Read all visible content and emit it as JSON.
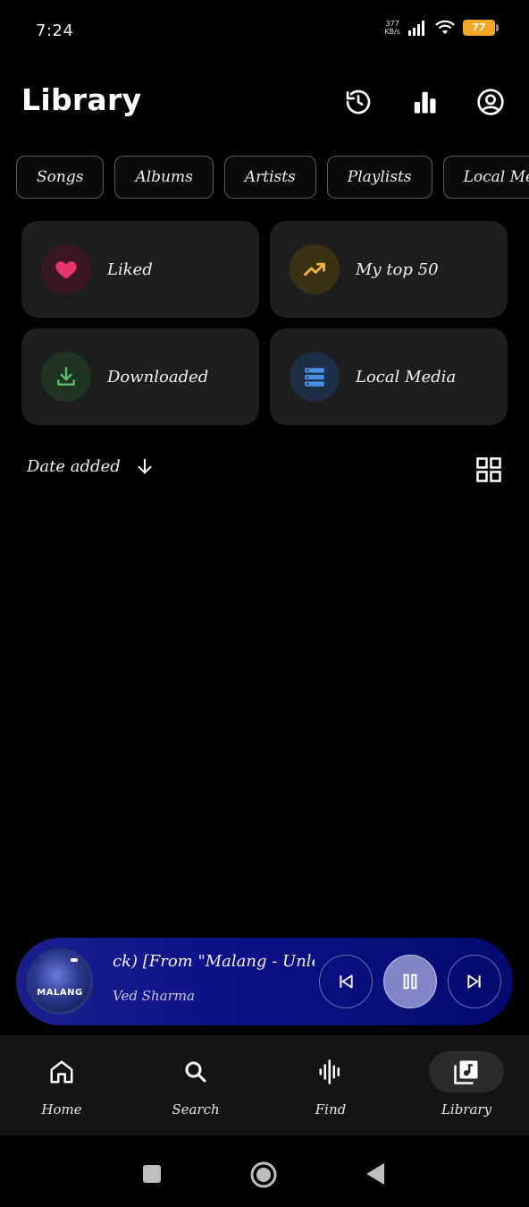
{
  "status": {
    "time": "7:24",
    "net_speed_value": "377",
    "net_speed_unit": "KB/s",
    "battery": "77"
  },
  "header": {
    "title": "Library",
    "icons": [
      "history-icon",
      "stats-icon",
      "account-icon"
    ]
  },
  "chips": [
    {
      "label": "Songs"
    },
    {
      "label": "Albums"
    },
    {
      "label": "Artists"
    },
    {
      "label": "Playlists"
    },
    {
      "label": "Local Media"
    }
  ],
  "cards": [
    {
      "label": "Liked",
      "icon": "heart-icon",
      "icon_color": "#e8346a",
      "bg": "#3a1822"
    },
    {
      "label": "My top 50",
      "icon": "trending-up-icon",
      "icon_color": "#f2b632",
      "bg": "#3a3014"
    },
    {
      "label": "Downloaded",
      "icon": "download-icon",
      "icon_color": "#5fbf6a",
      "bg": "#1f3323"
    },
    {
      "label": "Local Media",
      "icon": "storage-icon",
      "icon_color": "#4a8ee0",
      "bg": "#1c2d44"
    }
  ],
  "sort": {
    "label": "Date added",
    "direction_icon": "arrow-down-icon"
  },
  "player": {
    "title": "ck) [From \"Malang - Unleashed\"]",
    "artist": "Ved Sharma",
    "album_art_text": "MALANG"
  },
  "nav": {
    "items": [
      {
        "label": "Home",
        "icon": "home-icon"
      },
      {
        "label": "Search",
        "icon": "search-icon"
      },
      {
        "label": "Find",
        "icon": "waveform-icon"
      },
      {
        "label": "Library",
        "icon": "library-music-icon",
        "active": true
      }
    ]
  },
  "colors": {
    "accent_player": "#0d128a",
    "card_bg": "#1e1e1e",
    "battery": "#f5a623"
  }
}
